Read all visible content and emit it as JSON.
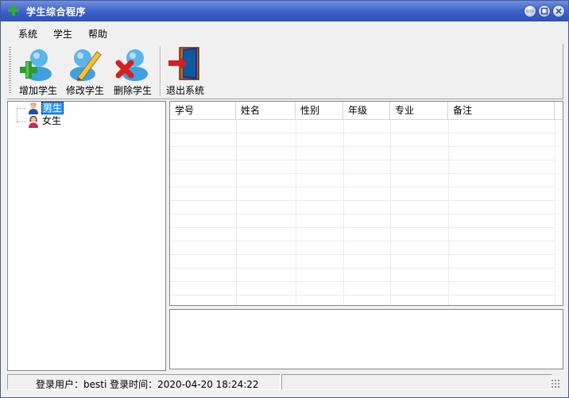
{
  "window": {
    "title": "学生综合程序"
  },
  "menu": [
    "系统",
    "学生",
    "帮助"
  ],
  "toolbar": {
    "add": "增加学生",
    "edit": "修改学生",
    "delete": "删除学生",
    "exit": "退出系统"
  },
  "tree": {
    "nodes": [
      {
        "label": "男生",
        "icon": "male-user-icon",
        "selected": true
      },
      {
        "label": "女生",
        "icon": "female-user-icon",
        "selected": false
      }
    ]
  },
  "grid": {
    "columns": [
      "学号",
      "姓名",
      "性别",
      "年级",
      "专业",
      "备注"
    ],
    "rows": []
  },
  "status": {
    "text": "登录用户：besti 登录时间：2020-04-20 18:24:22"
  },
  "colors": {
    "titlebar": "#3b5fc7",
    "selection": "#3399ff",
    "add_accent": "#2e9b2e",
    "delete_accent": "#d62020"
  }
}
